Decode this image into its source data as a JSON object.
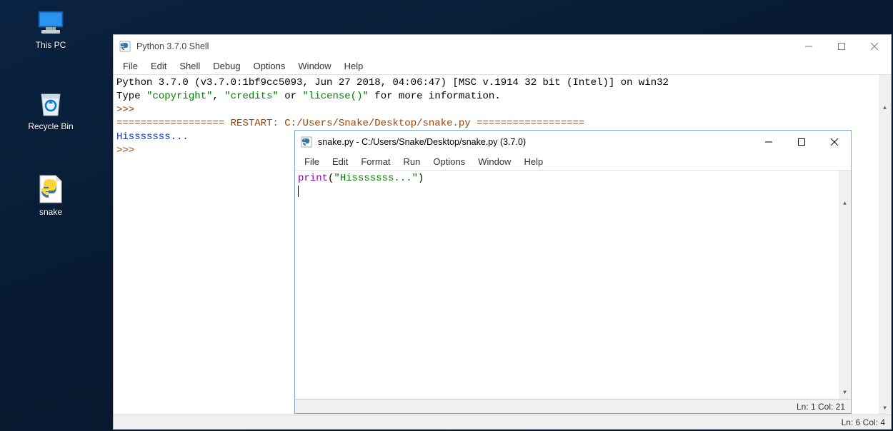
{
  "desktop": {
    "icons": [
      {
        "name": "this-pc",
        "label": "This PC"
      },
      {
        "name": "recycle-bin",
        "label": "Recycle Bin"
      },
      {
        "name": "snake",
        "label": "snake"
      }
    ]
  },
  "shell_window": {
    "title": "Python 3.7.0 Shell",
    "menus": [
      "File",
      "Edit",
      "Shell",
      "Debug",
      "Options",
      "Window",
      "Help"
    ],
    "banner_line1": "Python 3.7.0 (v3.7.0:1bf9cc5093, Jun 27 2018, 04:06:47) [MSC v.1914 32 bit (Intel)] on win32",
    "banner_line2_a": "Type ",
    "banner_line2_b": "\"copyright\"",
    "banner_line2_c": ", ",
    "banner_line2_d": "\"credits\"",
    "banner_line2_e": " or ",
    "banner_line2_f": "\"license()\"",
    "banner_line2_g": " for more information.",
    "prompt": ">>> ",
    "restart_eq_left": "================== ",
    "restart_word": "RESTART:",
    "restart_path": " C:/Users/Snake/Desktop/snake.py ",
    "restart_eq_right": "==================",
    "output": "Hisssssss...",
    "status": "Ln: 6  Col: 4"
  },
  "editor_window": {
    "title": "snake.py - C:/Users/Snake/Desktop/snake.py (3.7.0)",
    "menus": [
      "File",
      "Edit",
      "Format",
      "Run",
      "Options",
      "Window",
      "Help"
    ],
    "code_ident": "print",
    "code_paren_open": "(",
    "code_string": "\"Hisssssss...\"",
    "code_paren_close": ")",
    "status": "Ln: 1  Col: 21"
  }
}
